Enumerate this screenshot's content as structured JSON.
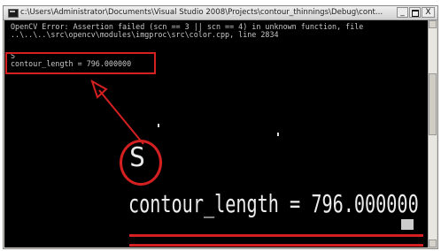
{
  "window": {
    "title": "c:\\Users\\Administrator\\Documents\\Visual Studio 2008\\Projects\\contour_thinnings\\Debug\\cont...",
    "controls": {
      "minimize": "_",
      "maximize": "",
      "close": "X"
    }
  },
  "console": {
    "lines": [
      "OpenCV Error: Assertion failed (scn == 3 || scn == 4) in unknown function, file",
      "..\\..\\..\\src\\opencv\\modules\\imgproc\\src\\color.cpp, line 2834",
      "S",
      "contour_length = 796.000000"
    ]
  },
  "zoom": {
    "s_text": "S",
    "contour_text": "contour_length = 796.000000"
  },
  "colors": {
    "annotation": "#d42020",
    "console_bg": "#000000",
    "console_text": "#c8c8c8"
  }
}
